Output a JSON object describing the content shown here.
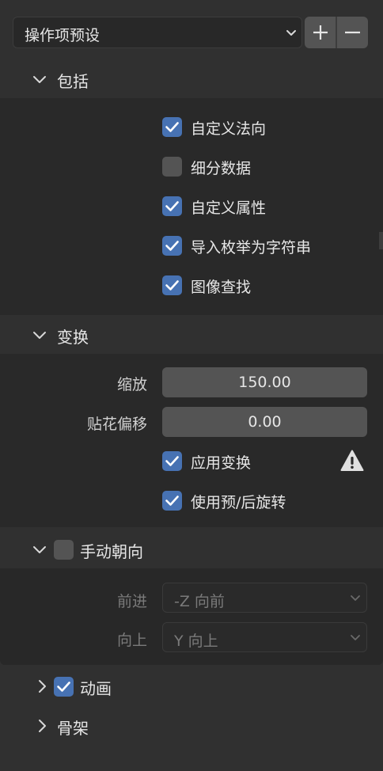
{
  "preset": {
    "label": "操作项预设",
    "icons": {
      "dropdown": "chevron-down-icon",
      "add": "plus-icon",
      "remove": "minus-icon"
    }
  },
  "include": {
    "title": "包括",
    "expanded": true,
    "options": [
      {
        "label": "自定义法向",
        "checked": true
      },
      {
        "label": "细分数据",
        "checked": false
      },
      {
        "label": "自定义属性",
        "checked": true
      },
      {
        "label": "导入枚举为字符串",
        "checked": true
      },
      {
        "label": "图像查找",
        "checked": true
      }
    ]
  },
  "transform": {
    "title": "变换",
    "expanded": true,
    "scale_label": "缩放",
    "scale_value": "150.00",
    "decal_label": "贴花偏移",
    "decal_value": "0.00",
    "apply_label": "应用变换",
    "apply_checked": true,
    "warning_icon": "warning-icon",
    "prepost_label": "使用预/后旋转",
    "prepost_checked": true
  },
  "manual_orientation": {
    "title": "手动朝向",
    "enabled": false,
    "expanded": true,
    "forward_label": "前进",
    "forward_value": "-Z 向前",
    "up_label": "向上",
    "up_value": "Y 向上"
  },
  "animation": {
    "title": "动画",
    "enabled": true,
    "expanded": false
  },
  "armature": {
    "title": "骨架",
    "expanded": false
  },
  "colors": {
    "accent": "#4772b3",
    "panel_bg": "#292929",
    "window_bg": "#303030",
    "field_bg": "#545454",
    "text": "#e6e6e6",
    "disabled_text": "#7a7a7a"
  }
}
